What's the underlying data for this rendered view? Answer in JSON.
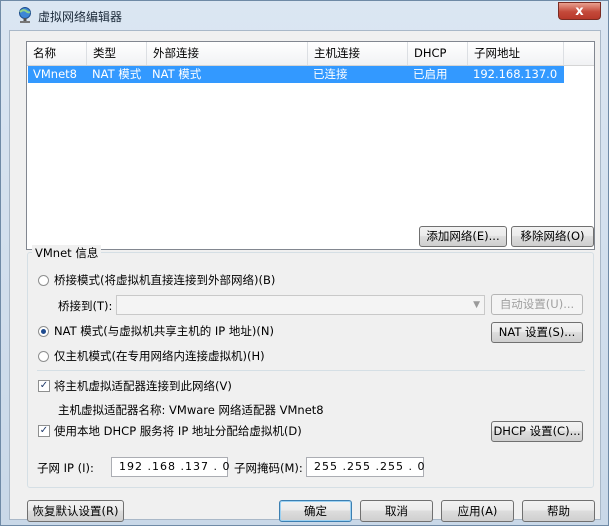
{
  "window": {
    "title": "虚拟网络编辑器",
    "close_glyph": "x"
  },
  "network_list": {
    "columns": [
      "名称",
      "类型",
      "外部连接",
      "主机连接",
      "DHCP",
      "子网地址"
    ],
    "rows": [
      {
        "name": "VMnet8",
        "type": "NAT 模式",
        "external": "NAT 模式",
        "host": "已连接",
        "dhcp": "已启用",
        "subnet": "192.168.137.0"
      }
    ]
  },
  "list_buttons": {
    "add": "添加网络(E)...",
    "remove": "移除网络(O)"
  },
  "vmnet_info": {
    "group_title": "VMnet 信息",
    "bridged": {
      "label": "桥接模式(将虚拟机直接连接到外部网络)(B)",
      "bridge_to_label": "桥接到(T):",
      "auto_button": "自动设置(U)..."
    },
    "nat": {
      "label": "NAT 模式(与虚拟机共享主机的 IP 地址)(N)",
      "settings_button": "NAT 设置(S)..."
    },
    "host_only": {
      "label": "仅主机模式(在专用网络内连接虚拟机)(H)"
    },
    "connect_adapter": {
      "label": "将主机虚拟适配器连接到此网络(V)",
      "checked": true
    },
    "adapter_name": {
      "label": "主机虚拟适配器名称: VMware 网络适配器 VMnet8"
    },
    "use_dhcp": {
      "label": "使用本地 DHCP 服务将 IP 地址分配给虚拟机(D)",
      "checked": true,
      "settings_button": "DHCP 设置(C)..."
    },
    "subnet_ip": {
      "label": "子网 IP (I):",
      "value": "192 .168 .137 . 0"
    },
    "subnet_mask": {
      "label": "子网掩码(M):",
      "value": "255 .255 .255 . 0"
    }
  },
  "footer": {
    "restore": "恢复默认设置(R)",
    "ok": "确定",
    "cancel": "取消",
    "apply": "应用(A)",
    "help": "帮助"
  }
}
